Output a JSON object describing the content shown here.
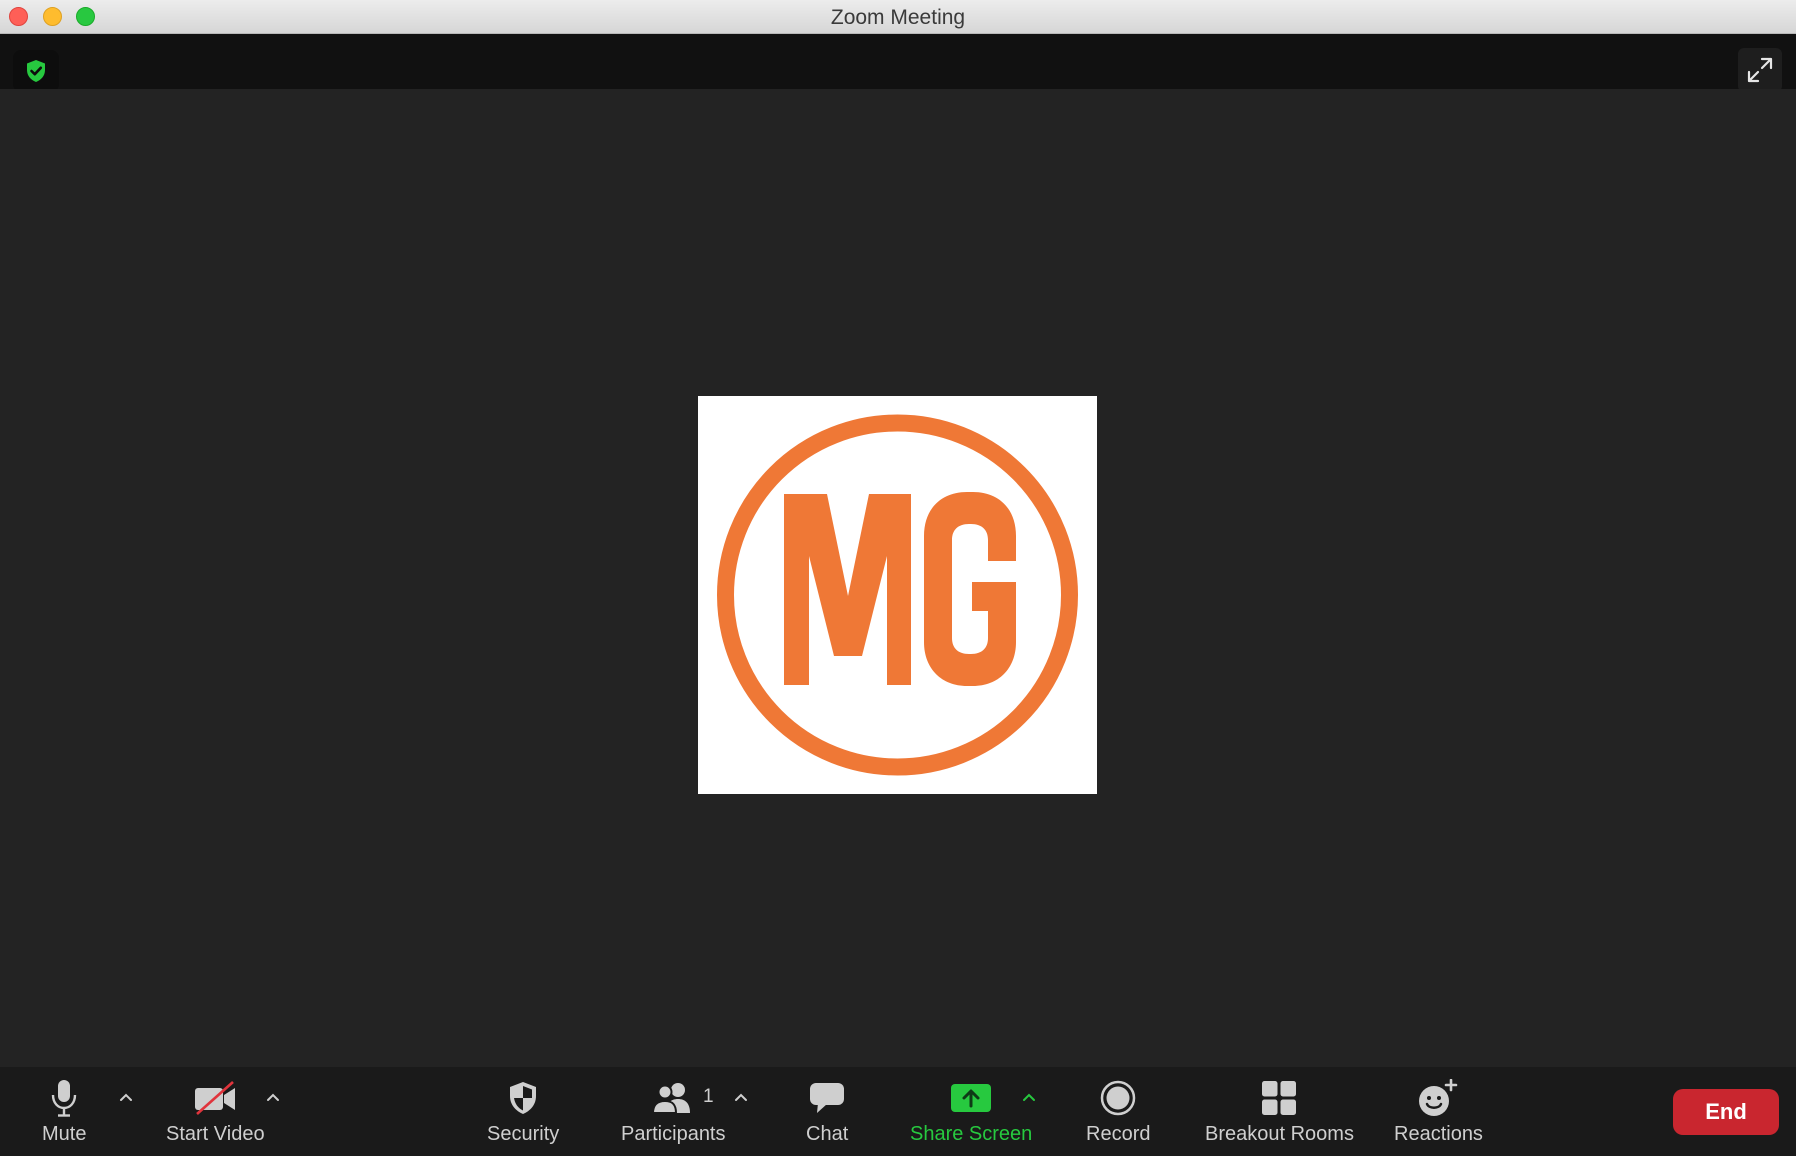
{
  "window": {
    "title": "Zoom Meeting"
  },
  "participant_avatar": {
    "logo_text": "MG",
    "logo_color": "#ef7836"
  },
  "toolbar": {
    "mute_label": "Mute",
    "video_label": "Start Video",
    "security_label": "Security",
    "participants_label": "Participants",
    "participants_count": "1",
    "chat_label": "Chat",
    "share_label": "Share Screen",
    "record_label": "Record",
    "breakout_label": "Breakout Rooms",
    "reactions_label": "Reactions",
    "end_label": "End"
  },
  "colors": {
    "accent_green": "#27c93f",
    "end_red": "#c9262f",
    "background": "#232323"
  },
  "icons": [
    "shield-check-icon",
    "fullscreen-icon",
    "microphone-icon",
    "video-off-icon",
    "shield-icon",
    "participants-icon",
    "chat-icon",
    "share-screen-icon",
    "record-icon",
    "breakout-rooms-icon",
    "reactions-icon",
    "chevron-up-icon"
  ]
}
